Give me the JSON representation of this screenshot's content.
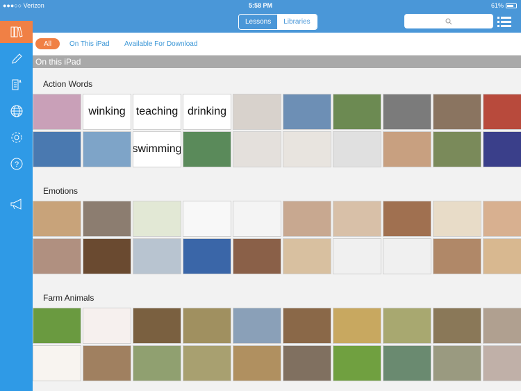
{
  "status_bar": {
    "carrier": "●●●○○ Verizon",
    "time": "5:58 PM",
    "battery": "61%"
  },
  "nav": {
    "segments": [
      "Lessons",
      "Libraries"
    ],
    "active_segment": "Lessons"
  },
  "sidebar": {
    "items": [
      "libraries-icon",
      "pencil-icon",
      "document-icon",
      "globe-icon",
      "gear-icon",
      "help-icon",
      "megaphone-icon"
    ]
  },
  "filters": {
    "all": "All",
    "on_ipad": "On This iPad",
    "download": "Available For Download"
  },
  "section_title": "On this iPad",
  "groups": [
    {
      "title": "Action Words",
      "tiles": [
        {
          "label": "",
          "color": "#c9a0b8"
        },
        {
          "label": "winking"
        },
        {
          "label": "teaching"
        },
        {
          "label": "drinking"
        },
        {
          "label": "",
          "color": "#d8d2cc"
        },
        {
          "label": "",
          "color": "#6d8fb5"
        },
        {
          "label": "",
          "color": "#6c8a52"
        },
        {
          "label": "",
          "color": "#7b7b7b"
        },
        {
          "label": "",
          "color": "#8a7460"
        },
        {
          "label": "",
          "color": "#b84a3c"
        },
        {
          "label": "",
          "color": "#4a79b0"
        },
        {
          "label": "",
          "color": "#7ea4c8"
        },
        {
          "label": "swimming"
        },
        {
          "label": "",
          "color": "#5a8a5a"
        },
        {
          "label": "",
          "color": "#e4e0dc"
        },
        {
          "label": "",
          "color": "#e8e4df"
        },
        {
          "label": "",
          "color": "#e0e0e0"
        },
        {
          "label": "",
          "color": "#c8a080"
        },
        {
          "label": "",
          "color": "#7a8a5a"
        },
        {
          "label": "",
          "color": "#3a3f8a"
        }
      ]
    },
    {
      "title": "Emotions",
      "tiles": [
        {
          "label": "",
          "color": "#c8a37a"
        },
        {
          "label": "",
          "color": "#8c7d70"
        },
        {
          "label": "",
          "color": "#e2e8d5"
        },
        {
          "label": "",
          "color": "#f8f8f8"
        },
        {
          "label": "",
          "color": "#f4f4f4"
        },
        {
          "label": "",
          "color": "#c8a890"
        },
        {
          "label": "",
          "color": "#d8c0a8"
        },
        {
          "label": "",
          "color": "#a07050"
        },
        {
          "label": "",
          "color": "#e8dcc8"
        },
        {
          "label": "",
          "color": "#d8b090"
        },
        {
          "label": "",
          "color": "#b09080"
        },
        {
          "label": "",
          "color": "#6a4a30"
        },
        {
          "label": "",
          "color": "#b8c4d0"
        },
        {
          "label": "",
          "color": "#3a66a8"
        },
        {
          "label": "",
          "color": "#8a6048"
        },
        {
          "label": "",
          "color": "#d8c0a0"
        },
        {
          "label": "",
          "color": "#f0f0f0"
        },
        {
          "label": "",
          "color": "#f0f0f0"
        },
        {
          "label": "",
          "color": "#b08868"
        },
        {
          "label": "",
          "color": "#d8b890"
        }
      ]
    },
    {
      "title": "Farm Animals",
      "tiles": [
        {
          "label": "",
          "color": "#6a9a40"
        },
        {
          "label": "",
          "color": "#f6f0ee"
        },
        {
          "label": "",
          "color": "#7a6040"
        },
        {
          "label": "",
          "color": "#a09060"
        },
        {
          "label": "",
          "color": "#8aa0b8"
        },
        {
          "label": "",
          "color": "#8a6848"
        },
        {
          "label": "",
          "color": "#c8a860"
        },
        {
          "label": "",
          "color": "#a8a870"
        },
        {
          "label": "",
          "color": "#8a7858"
        },
        {
          "label": "",
          "color": "#b0a090"
        },
        {
          "label": "",
          "color": "#f8f4f0"
        },
        {
          "label": "",
          "color": "#a08060"
        },
        {
          "label": "",
          "color": "#90a070"
        },
        {
          "label": "",
          "color": "#a8a070"
        },
        {
          "label": "",
          "color": "#b09060"
        },
        {
          "label": "",
          "color": "#807060"
        },
        {
          "label": "",
          "color": "#70a040"
        },
        {
          "label": "",
          "color": "#6a8a70"
        },
        {
          "label": "",
          "color": "#9a9a80"
        },
        {
          "label": "",
          "color": "#c0b0a8"
        }
      ]
    }
  ]
}
